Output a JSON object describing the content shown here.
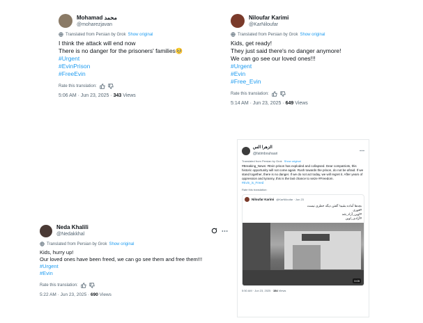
{
  "tweet1": {
    "name": "Mohamad",
    "name_extra": "محمد",
    "handle": "@moharezjavan",
    "translated_label": "Translated from Persian by Grok",
    "show_original": "Show original",
    "lines": [
      "I think the attack will end now",
      "There is no danger for the prisoners' families🥺"
    ],
    "tags": [
      "#Urgent",
      "#EvinPrison",
      "#FreeEvin"
    ],
    "rate_label": "Rate this translation:",
    "timestamp": "5:06 AM · Jun 23, 2025 ·",
    "views_count": "343",
    "views_label": "Views"
  },
  "tweet2": {
    "name": "Niloufar Karimi",
    "handle": "@KarNiloufar",
    "translated_label": "Translated from Persian by Grok",
    "show_original": "Show original",
    "lines": [
      "Kids, get ready!",
      "They just said there's no danger anymore!",
      "We can go see our loved ones!!!"
    ],
    "tags": [
      "#Urgent",
      "#Evin",
      "#Free_Evin"
    ],
    "rate_label": "Rate this translation:",
    "timestamp": "5:14 AM · Jun 23, 2025 ·",
    "views_count": "649",
    "views_label": "Views"
  },
  "tweet3": {
    "name": "Neda Khalili",
    "handle": "@Nedakkhal",
    "translated_label": "Translated from Persian by Grok",
    "show_original": "Show original",
    "lines": [
      "Kids, hurry up!",
      "Our loved ones have been freed, we can go see them and free them!!!"
    ],
    "tags": [
      "#Urgent",
      "#Evin"
    ],
    "rate_label": "Rate this translation:",
    "timestamp": "5:22 AM · Jun 23, 2025 ·",
    "views_count": "690",
    "views_label": "Views"
  },
  "tweet4": {
    "name": "الزهرا الس",
    "handle": "@fatimbouhaari",
    "translated_label": "Translated from Persian by Grok",
    "show_original": "Show original",
    "body": "#Breaking_News: #Evin prison has exploded and collapsed. Dear compatriots, this historic opportunity will not come again. Rush towards the prison, do not be afraid. If we stand together, there is no danger. If we do not act today, we will regret it. After years of oppression and tyranny, this is the last chance to seize #Freedom.",
    "tag_line": "#Evin_is_Freed",
    "rate_label": "Rate this translation:",
    "quoted": {
      "name": "Niloufar Karimi",
      "handle": "@KarNiloufar · Jun 23",
      "lines": [
        "بچه‌ها آماده بشید! گفتن دیگه خطری نیست",
        "#فوری",
        "#اوین_آزاد_شد",
        "#آزادی_اوین"
      ],
      "video_time": "0:05"
    },
    "timestamp": "5:50 AM · Jun 23, 2025 ·",
    "views_count": "154",
    "views_label": "Views"
  }
}
